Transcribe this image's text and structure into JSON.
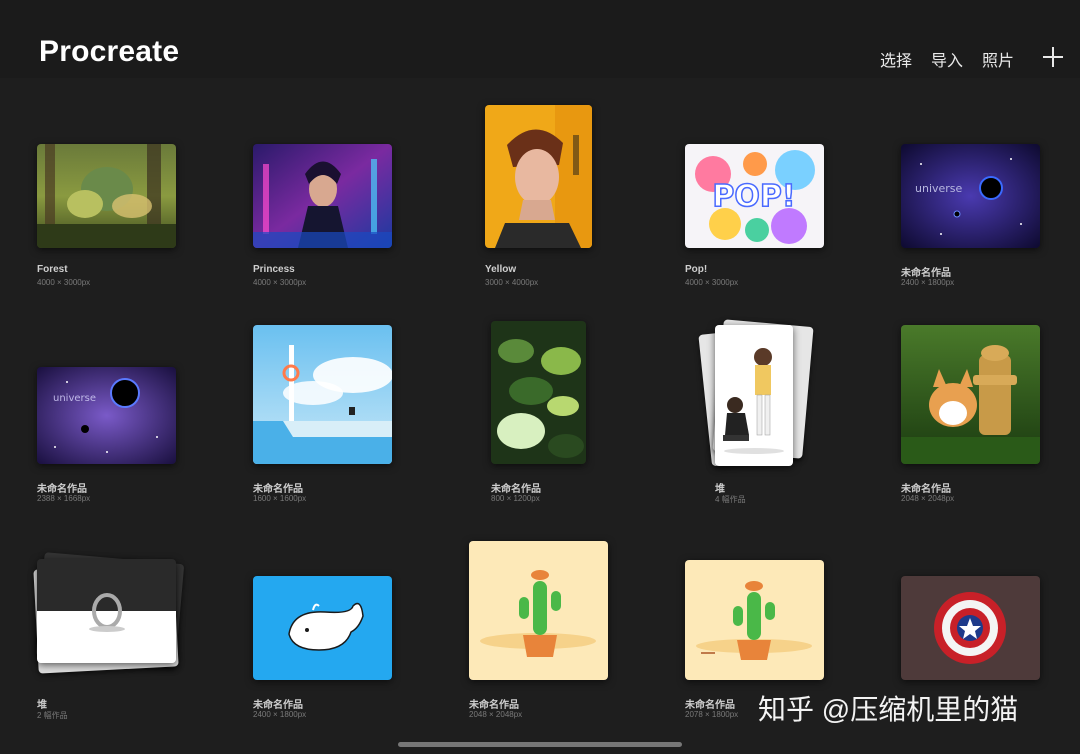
{
  "header": {
    "title": "Procreate",
    "select_label": "选择",
    "import_label": "导入",
    "photos_label": "照片"
  },
  "artworks": [
    {
      "name": "Forest",
      "size": "4000 × 3000px"
    },
    {
      "name": "Princess",
      "size": "4000 × 3000px"
    },
    {
      "name": "Yellow",
      "size": "3000 × 4000px"
    },
    {
      "name": "Pop!",
      "size": "4000 × 3000px"
    },
    {
      "name": "未命名作品",
      "size": "2400 × 1800px"
    },
    {
      "name": "未命名作品",
      "size": "2388 × 1668px"
    },
    {
      "name": "未命名作品",
      "size": "1600 × 1600px"
    },
    {
      "name": "未命名作品",
      "size": "800 × 1200px"
    },
    {
      "name": "堆",
      "size": "4 幅作品"
    },
    {
      "name": "未命名作品",
      "size": "2048 × 2048px"
    },
    {
      "name": "堆",
      "size": "2 幅作品"
    },
    {
      "name": "未命名作品",
      "size": "2400 × 1800px"
    },
    {
      "name": "未命名作品",
      "size": "2048 × 2048px"
    },
    {
      "name": "未命名作品",
      "size": "2078 × 1800px"
    }
  ],
  "art_text": {
    "pop": "POP!",
    "universe": "universe"
  },
  "watermark": "知乎 @压缩机里的猫"
}
